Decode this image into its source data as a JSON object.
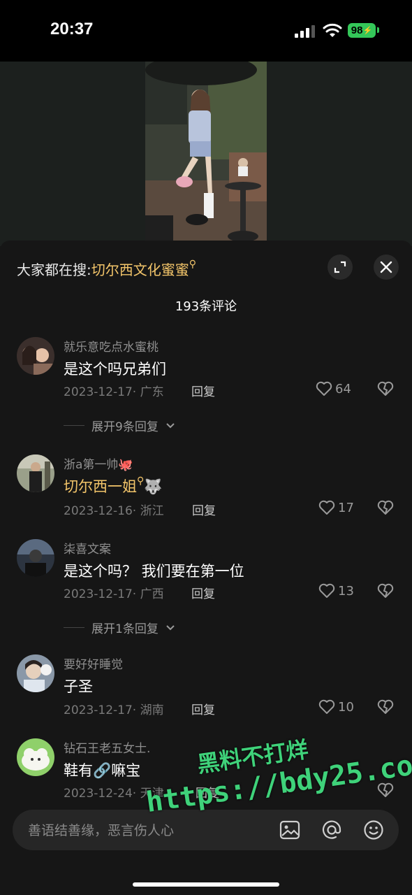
{
  "status_bar": {
    "time": "20:37",
    "battery": "98"
  },
  "header": {
    "search_prefix": "大家都在搜:",
    "search_keyword": "切尔西文化蜜蜜",
    "comment_count": "193条评论"
  },
  "comments": [
    {
      "username": "就乐意吃点水蜜桃",
      "text": "是这个吗兄弟们",
      "date": "2023-12-17",
      "location": "广东",
      "reply": "回复",
      "likes": "64",
      "expand": "展开9条回复"
    },
    {
      "username": "浙a第一帅",
      "username_emoji": "🐙",
      "text": "切尔西一姐",
      "text_emoji": "🐺",
      "date": "2023-12-16",
      "location": "浙江",
      "reply": "回复",
      "likes": "17"
    },
    {
      "username": "柒喜文案",
      "text": "是这个吗？ 我们要在第一位",
      "date": "2023-12-17",
      "location": "广西",
      "reply": "回复",
      "likes": "13",
      "expand": "展开1条回复"
    },
    {
      "username": "要好好睡觉",
      "text": "子圣",
      "date": "2023-12-17",
      "location": "湖南",
      "reply": "回复",
      "likes": "10"
    },
    {
      "username": "钻石王老五女士.",
      "text": "鞋有🔗嘛宝",
      "date": "2023-12-24",
      "location": "天津",
      "reply": "回复"
    }
  ],
  "input": {
    "placeholder": "善语结善缘，恶言伤人心"
  },
  "watermark": {
    "line1": "黑料不打烊",
    "line2": "https://bdy25.co"
  },
  "colors": {
    "accent_gold": "#f3c56a",
    "watermark_green": "#3fd27a",
    "battery_green": "#34c759"
  }
}
